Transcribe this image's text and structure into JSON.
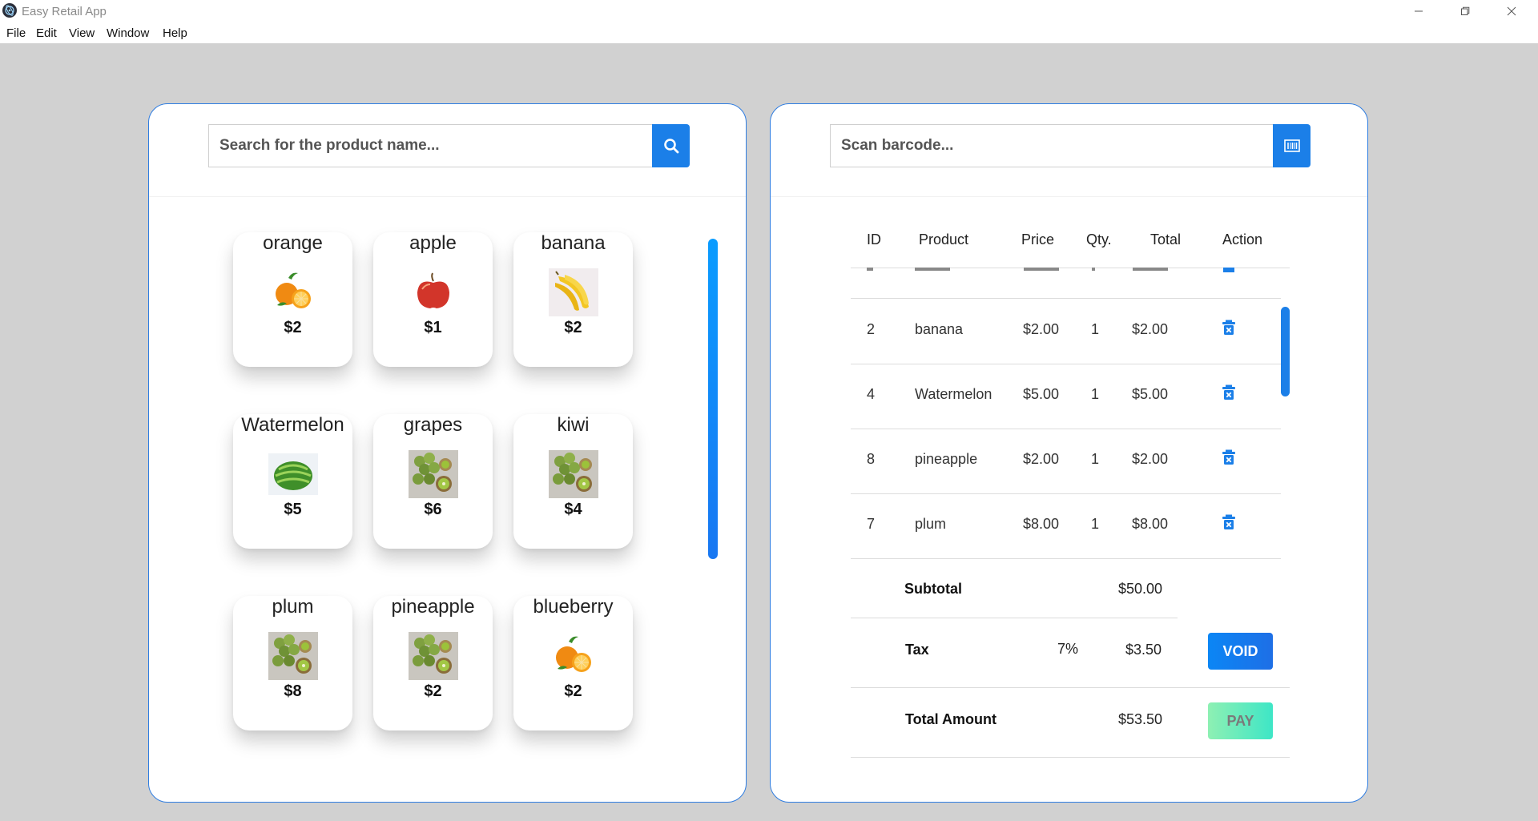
{
  "window": {
    "title": "Easy Retail App",
    "menu": [
      "File",
      "Edit",
      "View",
      "Window",
      "Help"
    ]
  },
  "product_panel": {
    "search_placeholder": "Search for the product name...",
    "products": [
      {
        "name": "orange",
        "price": "$2",
        "icon": "orange-icon"
      },
      {
        "name": "apple",
        "price": "$1",
        "icon": "apple-icon"
      },
      {
        "name": "banana",
        "price": "$2",
        "icon": "banana-icon"
      },
      {
        "name": "Watermelon",
        "price": "$5",
        "icon": "watermelon-icon"
      },
      {
        "name": "grapes",
        "price": "$6",
        "icon": "grapes-kiwi-icon"
      },
      {
        "name": "kiwi",
        "price": "$4",
        "icon": "grapes-kiwi-icon"
      },
      {
        "name": "plum",
        "price": "$8",
        "icon": "grapes-kiwi-icon"
      },
      {
        "name": "pineapple",
        "price": "$2",
        "icon": "grapes-kiwi-icon"
      },
      {
        "name": "blueberry",
        "price": "$2",
        "icon": "orange-icon"
      }
    ]
  },
  "cart_panel": {
    "barcode_placeholder": "Scan barcode...",
    "columns": [
      "ID",
      "Product",
      "Price",
      "Qty.",
      "Total",
      "Action"
    ],
    "rows": [
      {
        "id": "2",
        "product": "banana",
        "price": "$2.00",
        "qty": "1",
        "total": "$2.00"
      },
      {
        "id": "4",
        "product": "Watermelon",
        "price": "$5.00",
        "qty": "1",
        "total": "$5.00"
      },
      {
        "id": "8",
        "product": "pineapple",
        "price": "$2.00",
        "qty": "1",
        "total": "$2.00"
      },
      {
        "id": "7",
        "product": "plum",
        "price": "$8.00",
        "qty": "1",
        "total": "$8.00"
      }
    ],
    "subtotal_label": "Subtotal",
    "subtotal_value": "$50.00",
    "tax_label": "Tax",
    "tax_rate": "7%",
    "tax_value": "$3.50",
    "total_label": "Total Amount",
    "total_value": "$53.50",
    "void_label": "VOID",
    "pay_label": "PAY"
  },
  "colors": {
    "accent": "#1b7fe8",
    "panel_border": "#2f7de1",
    "background": "#d1d1d1",
    "pay_gradient_start": "#8ef0b3",
    "pay_gradient_end": "#3ee6c6"
  }
}
